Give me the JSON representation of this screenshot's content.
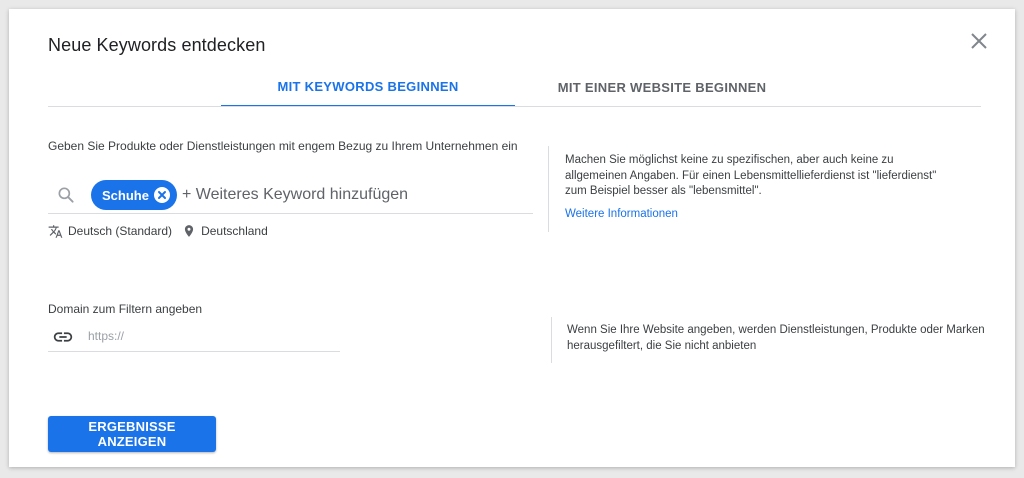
{
  "dialog": {
    "title": "Neue Keywords entdecken",
    "close_icon": "close-icon"
  },
  "tabs": [
    {
      "label": "MIT KEYWORDS BEGINNEN",
      "active": true
    },
    {
      "label": "MIT EINER WEBSITE BEGINNEN",
      "active": false
    }
  ],
  "keywords_section": {
    "label": "Geben Sie Produkte oder Dienstleistungen mit engem Bezug zu Ihrem Unternehmen ein",
    "chips": [
      {
        "label": "Schuhe"
      }
    ],
    "input_placeholder": "+ Weiteres Keyword hinzufügen",
    "language": "Deutsch (Standard)",
    "location": "Deutschland",
    "help_text": "Machen Sie möglichst keine zu spezifischen, aber auch keine zu allgemeinen Angaben. Für einen Lebensmittellieferdienst ist \"lieferdienst\" zum Beispiel besser als \"lebensmittel\".",
    "help_link": "Weitere Informationen"
  },
  "domain_section": {
    "label": "Domain zum Filtern angeben",
    "input_placeholder": "https://",
    "help_text": "Wenn Sie Ihre Website angeben, werden Dienstleistungen, Produkte oder Marken herausgefiltert, die Sie nicht anbieten"
  },
  "actions": {
    "show_results_label": "ERGEBNISSE ANZEIGEN"
  },
  "colors": {
    "accent": "#1a73e8",
    "text": "#3c4043",
    "divider": "#dadce0"
  }
}
